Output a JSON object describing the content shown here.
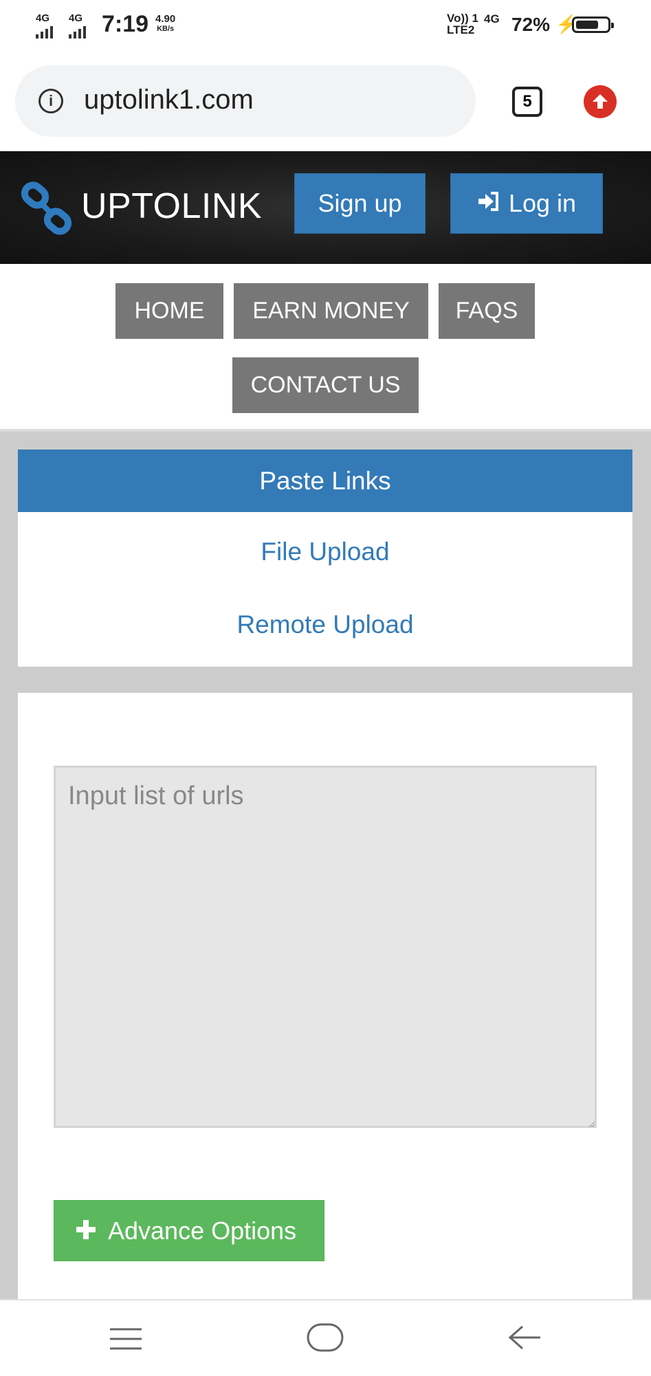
{
  "status_bar": {
    "sim1_label": "4G",
    "sim2_label": "4G",
    "time": "7:19",
    "speed_value": "4.90",
    "speed_unit": "KB/s",
    "volte_label": "Vo)) 1",
    "lte_label": "LTE2",
    "net_label": "4G",
    "battery_percent": "72%",
    "battery_level": 0.72
  },
  "browser": {
    "url": "uptolink1.com",
    "tab_count": "5"
  },
  "header": {
    "brand": "UPTOLINK",
    "signup_label": "Sign up",
    "login_label": "Log in"
  },
  "nav": {
    "items": [
      "HOME",
      "EARN MONEY",
      "FAQS",
      "CONTACT US"
    ]
  },
  "upload_tabs": {
    "active": "Paste Links",
    "file_upload": "File Upload",
    "remote_upload": "Remote Upload"
  },
  "form": {
    "urls_placeholder": "Input list of urls",
    "urls_value": "",
    "advance_label": "Advance Options"
  },
  "colors": {
    "primary": "#337ab7",
    "nav_gray": "#777777",
    "success": "#5cb85c",
    "header_dark": "#1a1a1a",
    "update_red": "#d93025"
  }
}
